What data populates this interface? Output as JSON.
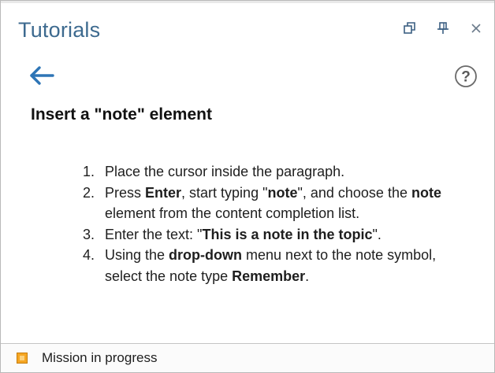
{
  "panel": {
    "title": "Tutorials",
    "controls": [
      "restore-icon",
      "pin-icon",
      "close-icon"
    ]
  },
  "nav": {
    "back_icon": "back-arrow-icon",
    "help_icon": "help-icon",
    "help_glyph": "?"
  },
  "tutorial": {
    "heading": "Insert a \"note\" element",
    "steps": [
      {
        "num": "1.",
        "parts": [
          {
            "text": "Place the cursor inside the paragraph.",
            "bold": false
          }
        ]
      },
      {
        "num": "2.",
        "parts": [
          {
            "text": "Press ",
            "bold": false
          },
          {
            "text": "Enter",
            "bold": true
          },
          {
            "text": ", start typing \"",
            "bold": false
          },
          {
            "text": "note",
            "bold": true
          },
          {
            "text": "\", and choose the ",
            "bold": false
          },
          {
            "text": "note",
            "bold": true
          },
          {
            "text": " element from the content completion list.",
            "bold": false
          }
        ]
      },
      {
        "num": "3.",
        "parts": [
          {
            "text": "Enter the text: \"",
            "bold": false
          },
          {
            "text": "This is a note in the topic",
            "bold": true
          },
          {
            "text": "\".",
            "bold": false
          }
        ]
      },
      {
        "num": "4.",
        "parts": [
          {
            "text": "Using the ",
            "bold": false
          },
          {
            "text": "drop-down",
            "bold": true
          },
          {
            "text": " menu next to the note symbol, select the note type ",
            "bold": false
          },
          {
            "text": "Remember",
            "bold": true
          },
          {
            "text": ".",
            "bold": false
          }
        ]
      }
    ]
  },
  "status": {
    "text": "Mission in progress",
    "color": "#f5a623"
  },
  "colors": {
    "title": "#3d6a8f",
    "accent": "#2e75b6"
  }
}
